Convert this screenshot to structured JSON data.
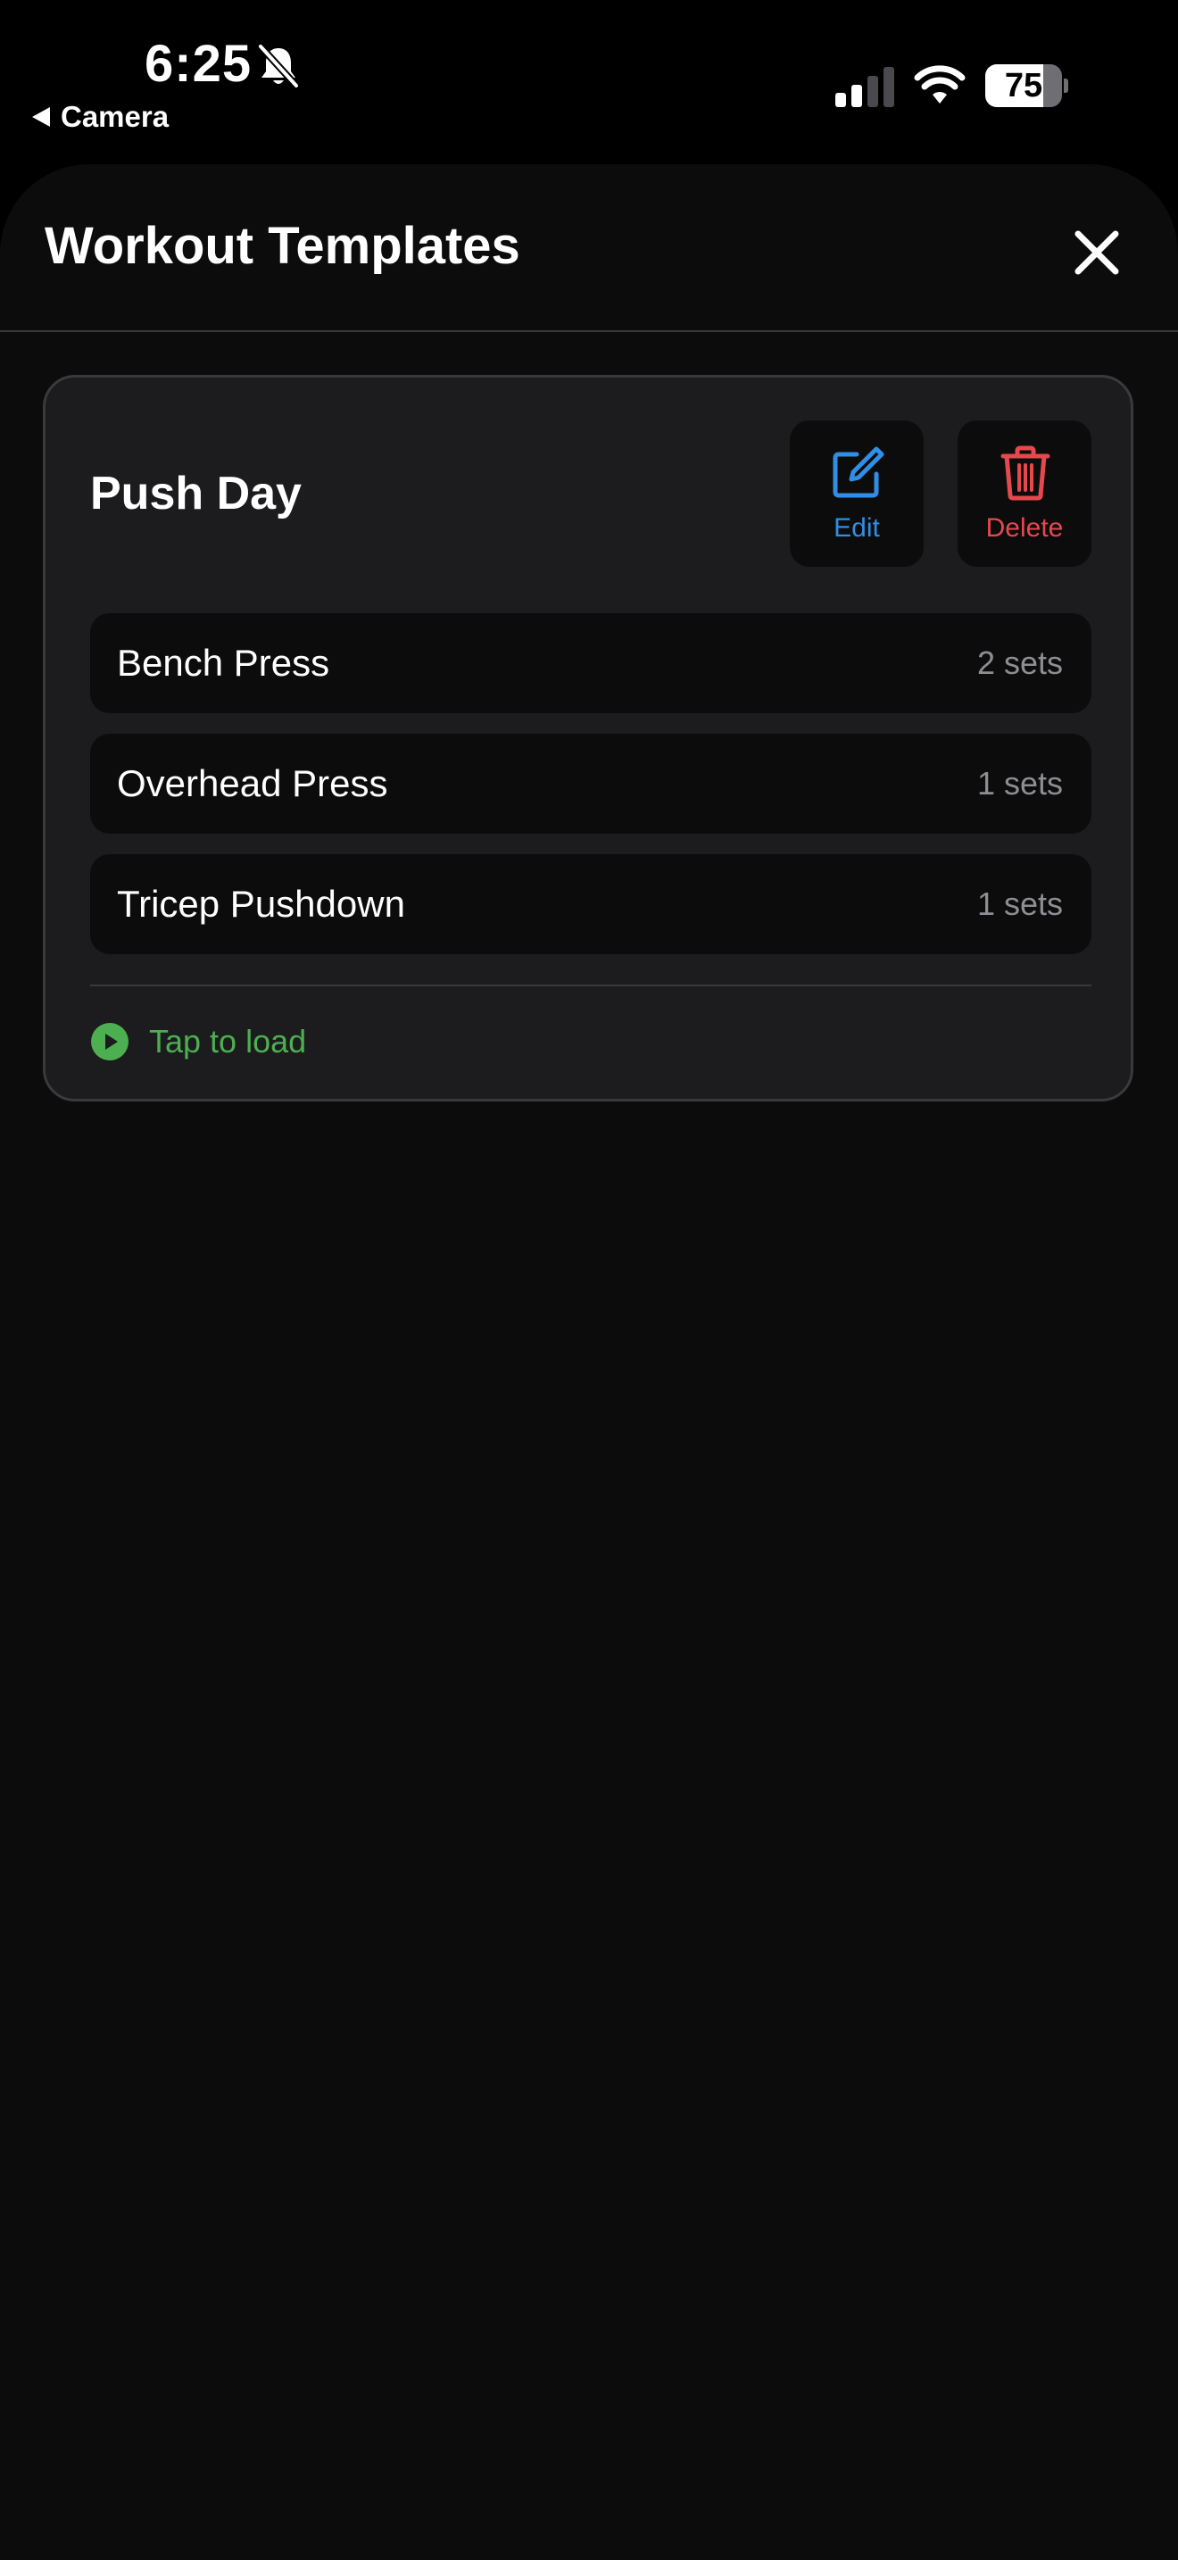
{
  "status_bar": {
    "time": "6:25",
    "back_label": "Camera",
    "battery_percent": 75,
    "battery_text": "75"
  },
  "header": {
    "title": "Workout Templates"
  },
  "template": {
    "name": "Push Day",
    "edit_label": "Edit",
    "delete_label": "Delete",
    "exercises": [
      {
        "name": "Bench Press",
        "sets": "2 sets"
      },
      {
        "name": "Overhead Press",
        "sets": "1 sets"
      },
      {
        "name": "Tricep Pushdown",
        "sets": "1 sets"
      }
    ],
    "load_label": "Tap to load"
  },
  "colors": {
    "accent_blue": "#2f8fe6",
    "danger_red": "#e5484d",
    "success_green": "#4caf50"
  },
  "icons": {
    "bell": "bell-slash-icon",
    "close": "close-icon",
    "edit": "edit-icon",
    "delete": "trash-icon",
    "load": "play-circle-icon"
  }
}
